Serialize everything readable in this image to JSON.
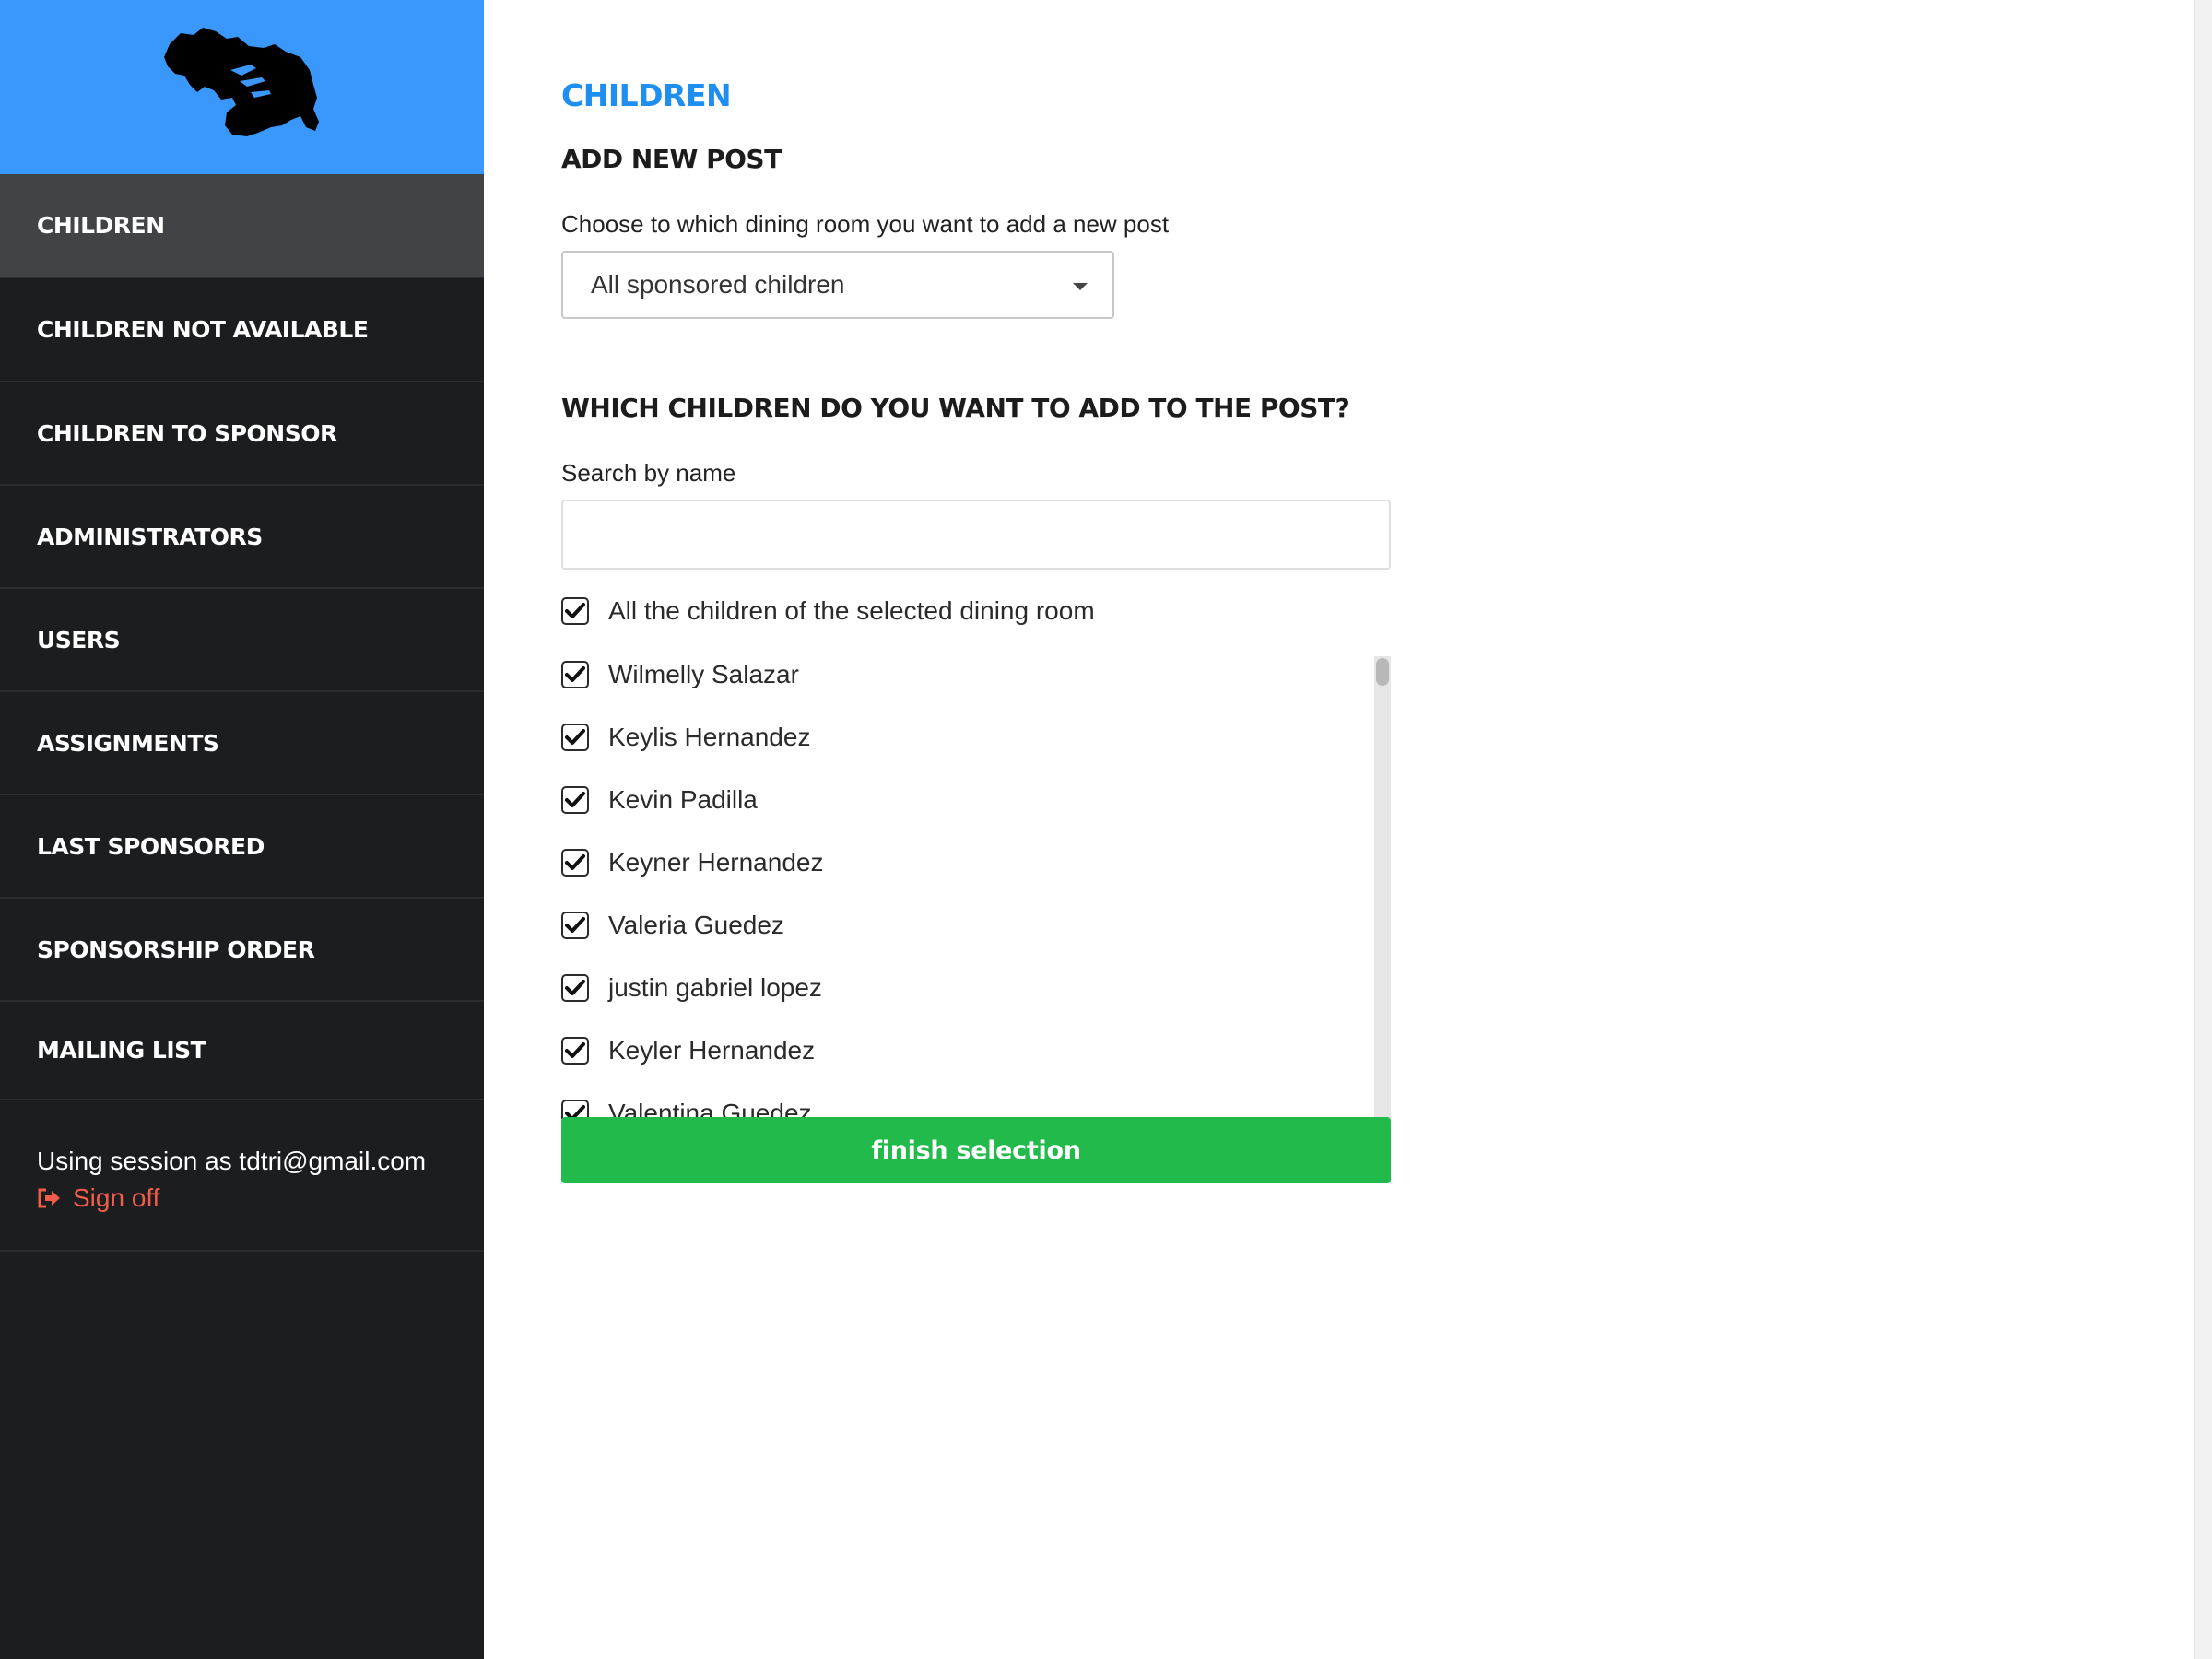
{
  "sidebar": {
    "logo_icon": "country-silhouette-logo",
    "items": [
      {
        "label": "CHILDREN",
        "active": true
      },
      {
        "label": "CHILDREN NOT AVAILABLE",
        "active": false
      },
      {
        "label": "CHILDREN TO SPONSOR",
        "active": false
      },
      {
        "label": "ADMINISTRATORS",
        "active": false
      },
      {
        "label": "USERS",
        "active": false
      },
      {
        "label": "ASSIGNMENTS",
        "active": false
      },
      {
        "label": "LAST SPONSORED",
        "active": false
      },
      {
        "label": "SPONSORSHIP ORDER",
        "active": false
      },
      {
        "label": "MAILING LIST",
        "active": false
      }
    ],
    "session_text": "Using session as tdtri@gmail.com",
    "signoff_label": "Sign off",
    "signoff_icon": "sign-out-icon"
  },
  "main": {
    "page_title": "CHILDREN",
    "add_post_heading": "ADD NEW POST",
    "dining_room_label": "Choose to which dining room you want to add a new post",
    "dining_room_selected": "All sponsored children",
    "children_heading": "WHICH CHILDREN DO YOU WANT TO ADD TO THE POST?",
    "search_label": "Search by name",
    "search_value": "",
    "select_all_label": "All the children of the selected dining room",
    "select_all_checked": true,
    "children": [
      {
        "name": "Wilmelly Salazar",
        "checked": true
      },
      {
        "name": "Keylis Hernandez",
        "checked": true
      },
      {
        "name": "Kevin Padilla",
        "checked": true
      },
      {
        "name": "Keyner Hernandez",
        "checked": true
      },
      {
        "name": "Valeria Guedez",
        "checked": true
      },
      {
        "name": "justin gabriel lopez",
        "checked": true
      },
      {
        "name": "Keyler Hernandez",
        "checked": true
      },
      {
        "name": "Valentina Guedez",
        "checked": true
      }
    ],
    "finish_button_label": "finish selection"
  },
  "colors": {
    "sidebar_bg": "#1c1d1f",
    "logo_bg": "#3a97fb",
    "active_item_bg": "#424346",
    "title_blue": "#1f8ef1",
    "signoff_red": "#f25c4a",
    "finish_green": "#22bb4b"
  }
}
